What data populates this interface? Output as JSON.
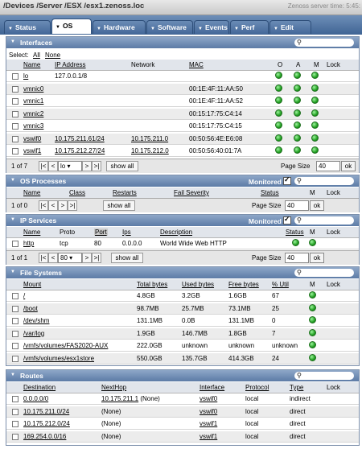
{
  "header": {
    "path": "/Devices /Server /ESX /esx1.zenoss.loc",
    "server_time": "Zenoss server time: 5:45:"
  },
  "tabs": [
    "Status",
    "OS",
    "Hardware",
    "Software",
    "Events",
    "Perf",
    "Edit"
  ],
  "interfaces": {
    "title": "Interfaces",
    "select_label": "Select:",
    "select_all": "All",
    "select_none": "None",
    "columns": [
      "Name",
      "IP Address",
      "Network",
      "MAC",
      "O",
      "A",
      "M",
      "Lock"
    ],
    "rows": [
      {
        "name": "lo",
        "ip": "127.0.0.1/8",
        "network": "",
        "mac": ""
      },
      {
        "name": "vmnic0",
        "ip": "",
        "network": "",
        "mac": "00:1E:4F:11:AA:50"
      },
      {
        "name": "vmnic1",
        "ip": "",
        "network": "",
        "mac": "00:1E:4F:11:AA:52"
      },
      {
        "name": "vmnic2",
        "ip": "",
        "network": "",
        "mac": "00:15:17:75:C4:14"
      },
      {
        "name": "vmnic3",
        "ip": "",
        "network": "",
        "mac": "00:15:17:75:C4:15"
      },
      {
        "name": "vswif0",
        "ip": "10.175.211.61/24",
        "network": "10.175.211.0",
        "mac": "00:50:56:4E:E6:08"
      },
      {
        "name": "vswif1",
        "ip": "10.175.212.27/24",
        "network": "10.175.212.0",
        "mac": "00:50:56:40:01:7A"
      }
    ],
    "pager": {
      "page": "1 of 7",
      "select": "lo",
      "show_all": "show all",
      "page_size_label": "Page Size",
      "page_size": "40",
      "ok": "ok"
    }
  },
  "os_processes": {
    "title": "OS Processes",
    "monitored": "Monitored",
    "columns": [
      "Name",
      "Class",
      "Restarts",
      "Fail Severity",
      "Status",
      "M",
      "Lock"
    ],
    "pager": {
      "page": "1 of 0",
      "show_all": "show all",
      "page_size_label": "Page Size",
      "page_size": "40",
      "ok": "ok"
    }
  },
  "ip_services": {
    "title": "IP Services",
    "monitored": "Monitored",
    "columns": [
      "Name",
      "Proto",
      "Port",
      "Ips",
      "Description",
      "Status",
      "M",
      "Lock"
    ],
    "rows": [
      {
        "name": "http",
        "proto": "tcp",
        "port": "80",
        "ips": "0.0.0.0",
        "description": "World Wide Web HTTP"
      }
    ],
    "pager": {
      "page": "1 of 1",
      "select": "80",
      "show_all": "show all",
      "page_size_label": "Page Size",
      "page_size": "40",
      "ok": "ok"
    }
  },
  "file_systems": {
    "title": "File Systems",
    "columns": [
      "Mount",
      "Total bytes",
      "Used bytes",
      "Free bytes",
      "% Util",
      "M",
      "Lock"
    ],
    "rows": [
      {
        "mount": "/",
        "total": "4.8GB",
        "used": "3.2GB",
        "free": "1.6GB",
        "util": "67"
      },
      {
        "mount": "/boot",
        "total": "98.7MB",
        "used": "25.7MB",
        "free": "73.1MB",
        "util": "25"
      },
      {
        "mount": "/dev/shm",
        "total": "131.1MB",
        "used": "0.0B",
        "free": "131.1MB",
        "util": "0"
      },
      {
        "mount": "/var/log",
        "total": "1.9GB",
        "used": "146.7MB",
        "free": "1.8GB",
        "util": "7"
      },
      {
        "mount": "/vmfs/volumes/FAS2020-AUX",
        "total": "222.0GB",
        "used": "unknown",
        "free": "unknown",
        "util": "unknown"
      },
      {
        "mount": "/vmfs/volumes/esx1store",
        "total": "550.0GB",
        "used": "135.7GB",
        "free": "414.3GB",
        "util": "24"
      }
    ]
  },
  "routes": {
    "title": "Routes",
    "columns": [
      "Destination",
      "NextHop",
      "Interface",
      "Protocol",
      "Type",
      "Lock"
    ],
    "rows": [
      {
        "dest": "0.0.0.0/0",
        "nexthop": "10.175.211.1 (None)",
        "iface": "vswif0",
        "proto": "local",
        "type": "indirect"
      },
      {
        "dest": "10.175.211.0/24",
        "nexthop": "(None)",
        "iface": "vswif0",
        "proto": "local",
        "type": "direct"
      },
      {
        "dest": "10.175.212.0/24",
        "nexthop": "(None)",
        "iface": "vswif1",
        "proto": "local",
        "type": "direct"
      },
      {
        "dest": "169.254.0.0/16",
        "nexthop": "(None)",
        "iface": "vswif1",
        "proto": "local",
        "type": "direct"
      }
    ]
  }
}
